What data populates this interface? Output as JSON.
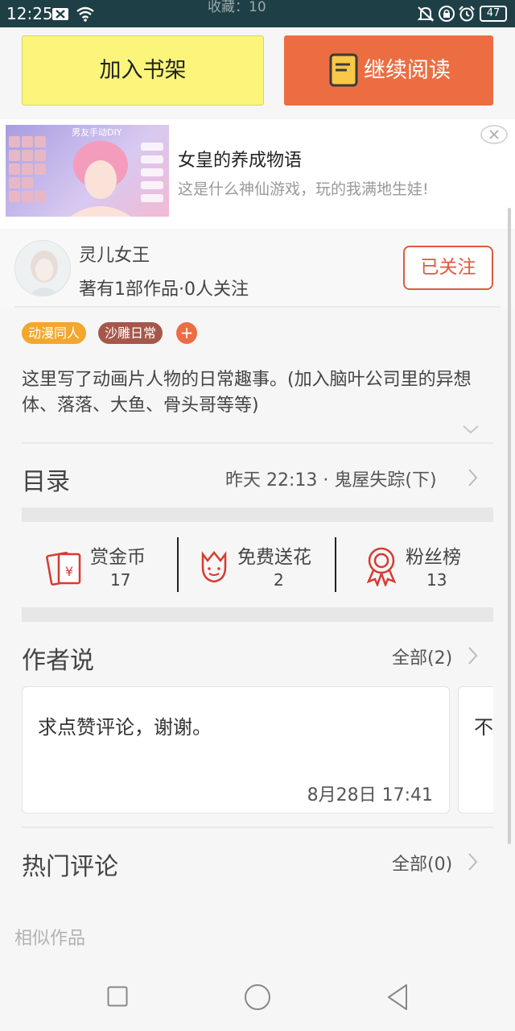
{
  "status_bar": {
    "time": "12:25",
    "behind_text": "收藏：10",
    "battery": "47"
  },
  "actions": {
    "add_shelf": "加入书架",
    "continue_read": "继续阅读"
  },
  "ad": {
    "title": "女皇的养成物语",
    "subtitle": "这是什么神仙游戏，玩的我满地生娃!",
    "thumb_caption": "男友手动DIY"
  },
  "author": {
    "name": "灵儿女王",
    "stats": "著有1部作品·0人关注",
    "follow_label": "已关注"
  },
  "tags": [
    "动漫同人",
    "沙雕日常"
  ],
  "tag_add": "+",
  "description": "这里写了动画片人物的日常趣事。(加入脑叶公司里的异想体、落落、大鱼、骨头哥等等)",
  "catalog": {
    "label": "目录",
    "latest": "昨天 22:13 · 鬼屋失踪(下)"
  },
  "stats": [
    {
      "label": "赏金币",
      "value": "17",
      "icon": "red-envelope-icon"
    },
    {
      "label": "免费送花",
      "value": "2",
      "icon": "flower-icon"
    },
    {
      "label": "粉丝榜",
      "value": "13",
      "icon": "medal-icon"
    }
  ],
  "author_says": {
    "label": "作者说",
    "all": "全部(2)",
    "cards": [
      {
        "text": "求点赞评论，谢谢。",
        "date": "8月28日  17:41"
      },
      {
        "text": "不"
      }
    ]
  },
  "hot_comments": {
    "label": "热门评论",
    "all": "全部(0)"
  },
  "similar_label": "相似作品",
  "colors": {
    "accent": "#ec6d42",
    "shelf_yellow": "#fbf57b",
    "follow_red": "#e0593f",
    "status_bar": "#1f3f46"
  }
}
